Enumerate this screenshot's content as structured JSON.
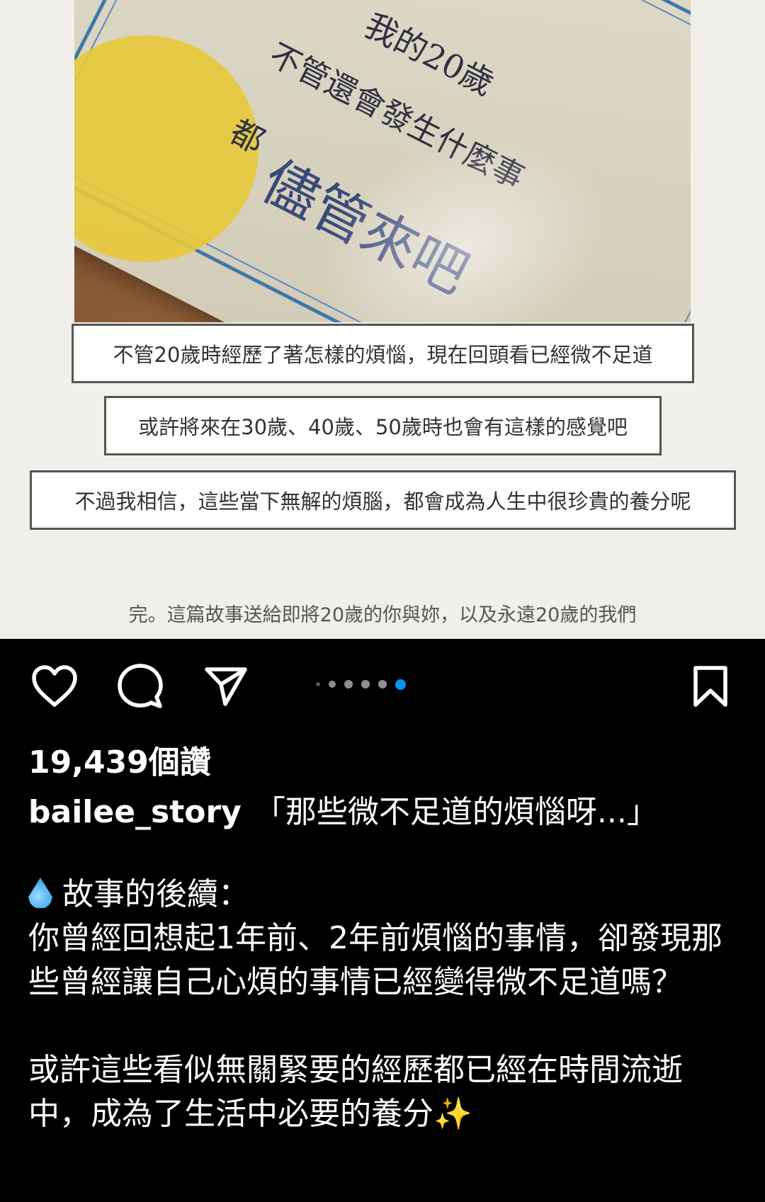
{
  "post": {
    "handwriting": {
      "line1": "我的20歲",
      "line2": "不管還會發生什麼事",
      "line3": "都",
      "line4": "儘管來吧"
    },
    "image_captions": [
      "不管20歲時經歷了著怎樣的煩惱，現在回頭看已經微不足道",
      "或許將來在30歲、40歲、50歲時也會有這樣的感覺吧",
      "不過我相信，這些當下無解的煩腦，都會成為人生中很珍貴的養分呢"
    ],
    "end_note": "完。這篇故事送給即將20歲的你與妳，以及永遠20歲的我們"
  },
  "actions": {
    "like_icon": "heart-icon",
    "comment_icon": "comment-bubble-icon",
    "share_icon": "paper-plane-icon",
    "save_icon": "bookmark-icon",
    "carousel": {
      "total_dots": 6,
      "active_index": 5,
      "active_color": "#0095f6"
    }
  },
  "likes": "19,439個讚",
  "caption": {
    "username": "bailee_story",
    "headline": "「那些微不足道的煩惱呀...」",
    "section_title": "故事的後續：",
    "paragraph1": "你曾經回想起1年前、2年前煩惱的事情，卻發現那些曾經讓自己心煩的事情已經變得微不足道嗎？",
    "paragraph2": "或許這些看似無關緊要的經歷都已經在時間流逝中，成為了生活中必要的養分",
    "emoji_drop": "droplet-emoji",
    "emoji_sparkles": "✨"
  }
}
